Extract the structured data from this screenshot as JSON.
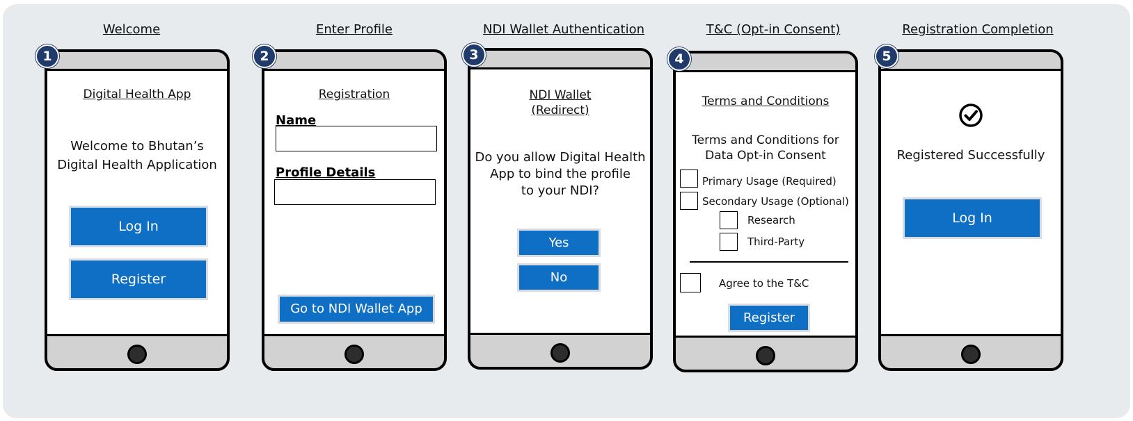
{
  "steps": [
    {
      "number": "1",
      "title": "Welcome"
    },
    {
      "number": "2",
      "title": "Enter Profile"
    },
    {
      "number": "3",
      "title": "NDI Wallet Authentication"
    },
    {
      "number": "4",
      "title": "T&C (Opt-in Consent)"
    },
    {
      "number": "5",
      "title": "Registration Completion"
    }
  ],
  "welcome": {
    "app_title": "Digital Health App ",
    "line1": "Welcome to Bhutan’s",
    "line2": "Digital Health Application",
    "login_label": "Log In",
    "register_label": "Register"
  },
  "profile": {
    "heading": "Registration",
    "name_label": "Name",
    "details_label": "Profile Details",
    "name_value": "",
    "details_value": "",
    "go_label": "Go to NDI Wallet App"
  },
  "ndi": {
    "heading1": "NDI Wallet",
    "heading2": "(Redirect)",
    "q1": "Do you allow Digital Health",
    "q2": "App to bind the profile",
    "q3": "to your NDI?",
    "yes_label": "Yes",
    "no_label": "No"
  },
  "terms": {
    "heading": "Terms and Conditions",
    "sub1": "Terms and Conditions for",
    "sub2": "Data Opt-in Consent",
    "primary": "Primary Usage (Required)",
    "secondary": "Secondary Usage (Optional)",
    "research": "Research",
    "third_party": "Third-Party",
    "agree": "Agree to the T&C",
    "register_label": "Register"
  },
  "complete": {
    "status": "Registered Successfully",
    "login_label": "Log In"
  }
}
